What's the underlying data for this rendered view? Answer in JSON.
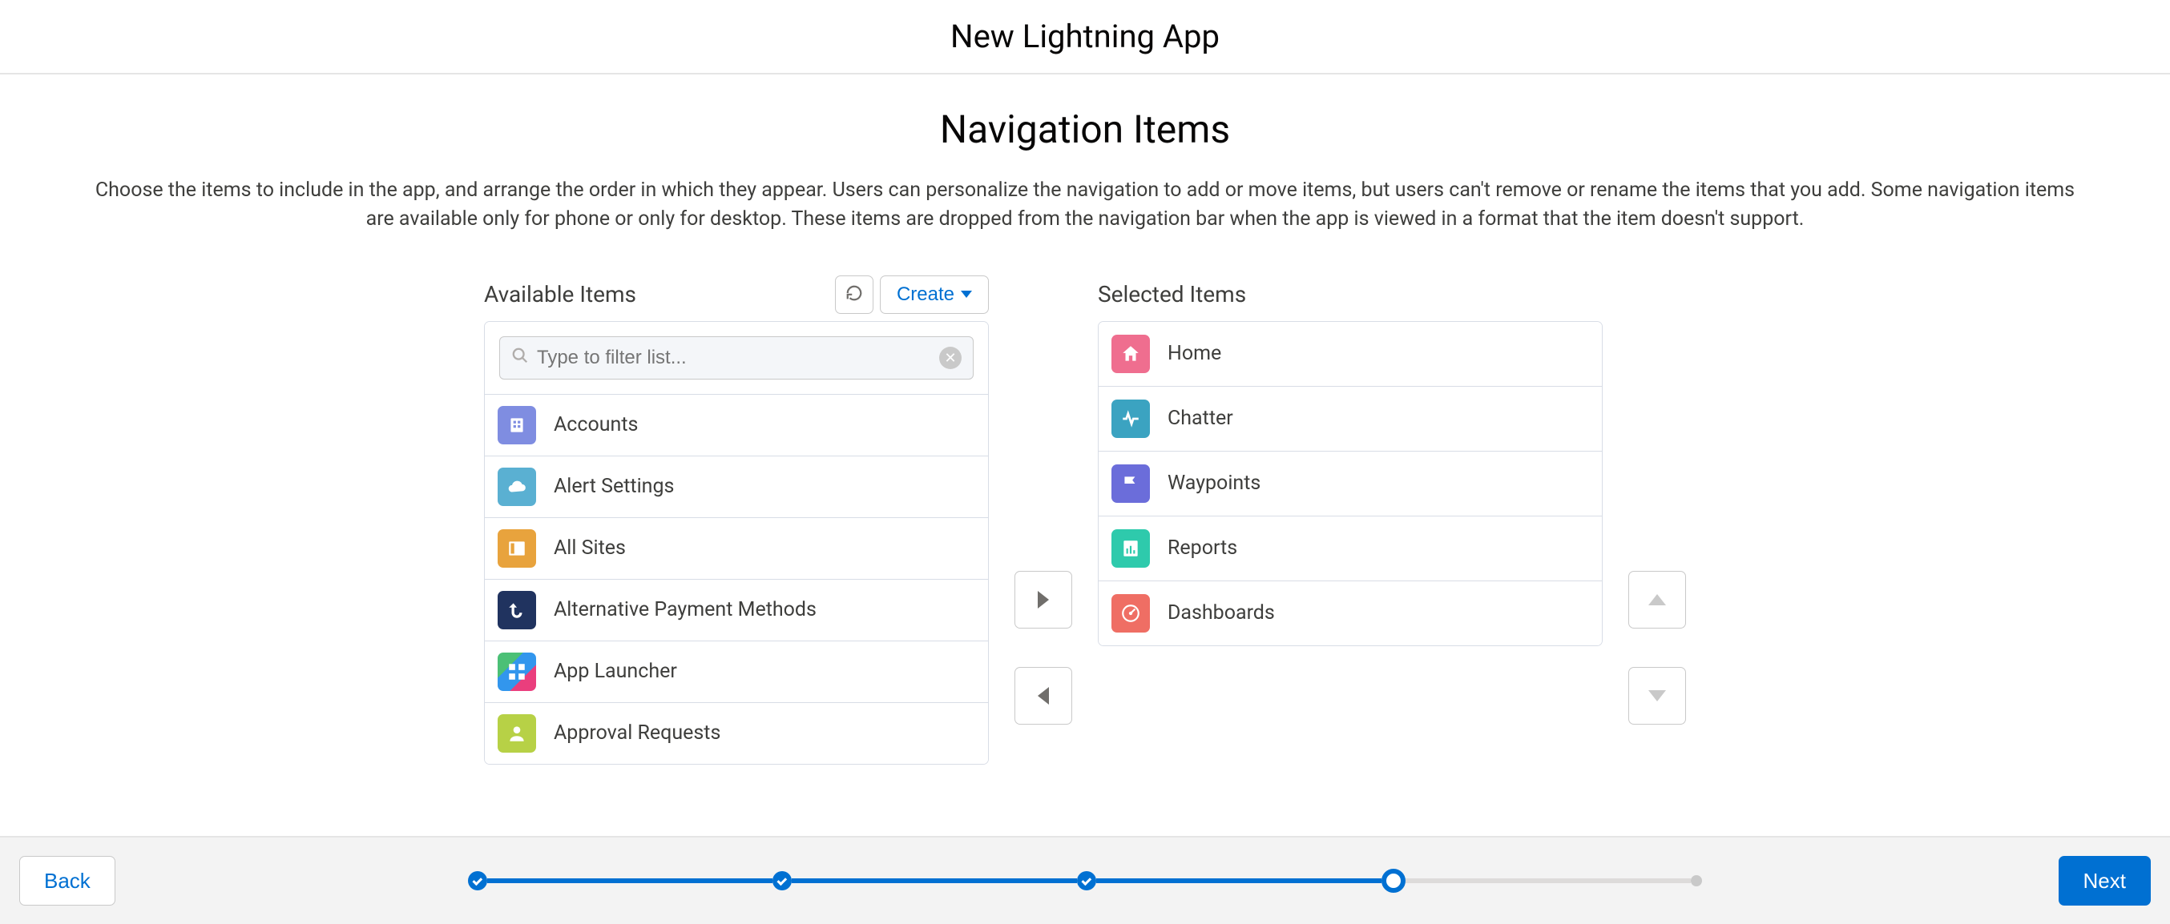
{
  "modalTitle": "New Lightning App",
  "sectionTitle": "Navigation Items",
  "sectionDesc": "Choose the items to include in the app, and arrange the order in which they appear. Users can personalize the navigation to add or move items, but users can't remove or rename the items that you add. Some navigation items are available only for phone or only for desktop. These items are dropped from the navigation bar when the app is viewed in a format that the item doesn't support.",
  "availableTitle": "Available Items",
  "selectedTitle": "Selected Items",
  "createLabel": "Create",
  "filterPlaceholder": "Type to filter list...",
  "available": [
    {
      "label": "Accounts",
      "iconClass": "bg-purple",
      "icon": "building"
    },
    {
      "label": "Alert Settings",
      "iconClass": "bg-lightblue",
      "icon": "cloud"
    },
    {
      "label": "All Sites",
      "iconClass": "bg-orange",
      "icon": "panel"
    },
    {
      "label": "Alternative Payment Methods",
      "iconClass": "bg-navy",
      "icon": "switch"
    },
    {
      "label": "App Launcher",
      "iconClass": "bg-tiles",
      "icon": "tiles"
    },
    {
      "label": "Approval Requests",
      "iconClass": "bg-lime",
      "icon": "person"
    }
  ],
  "selected": [
    {
      "label": "Home",
      "iconClass": "bg-pink",
      "icon": "home"
    },
    {
      "label": "Chatter",
      "iconClass": "bg-teal",
      "icon": "pulse"
    },
    {
      "label": "Waypoints",
      "iconClass": "bg-indigo",
      "icon": "flag"
    },
    {
      "label": "Reports",
      "iconClass": "bg-green2",
      "icon": "report"
    },
    {
      "label": "Dashboards",
      "iconClass": "bg-red",
      "icon": "gauge"
    }
  ],
  "footer": {
    "back": "Back",
    "next": "Next"
  },
  "progress": {
    "steps": [
      "done",
      "done",
      "done",
      "current",
      "upcoming"
    ]
  }
}
